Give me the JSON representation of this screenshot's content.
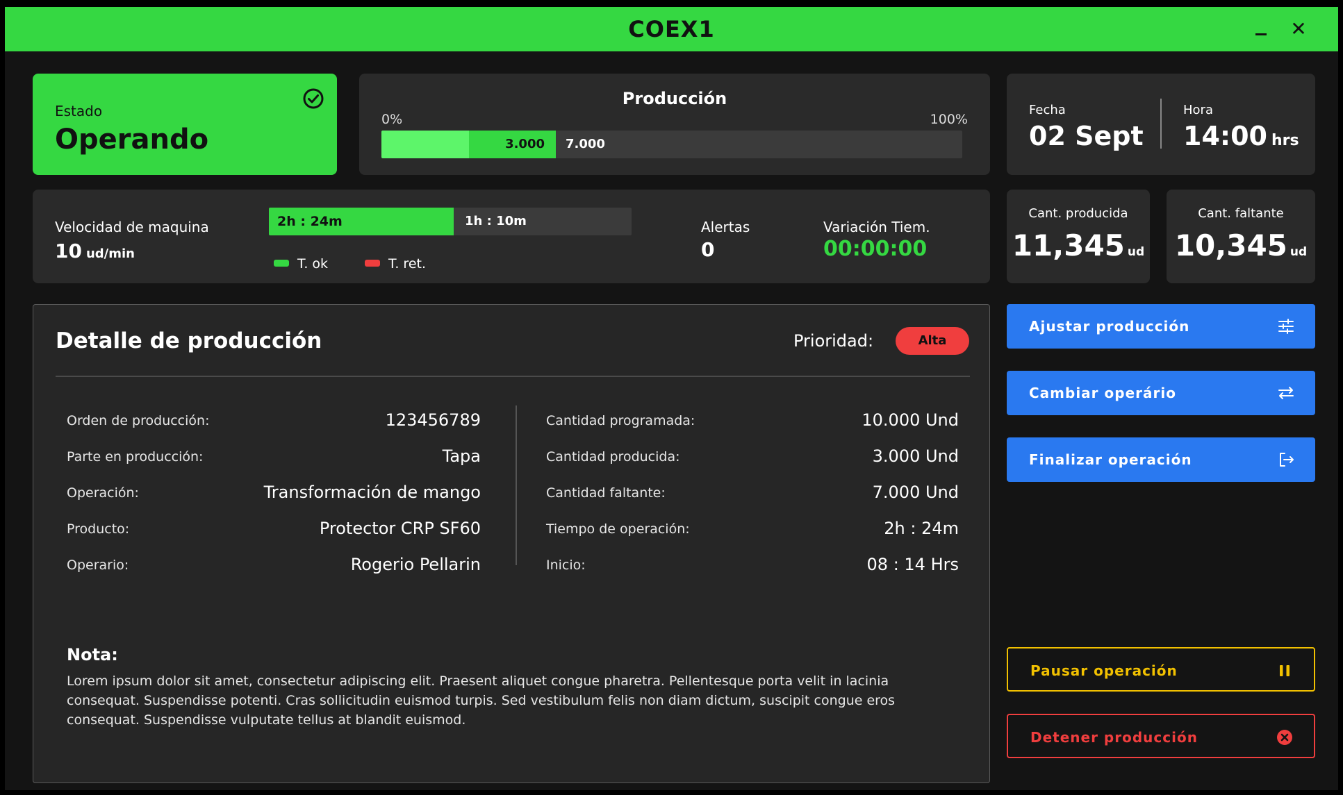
{
  "window": {
    "title": "COEX1",
    "minimize_label": "_",
    "close_label": "✕"
  },
  "estado": {
    "label": "Estado",
    "value": "Operando"
  },
  "produccion": {
    "title": "Producción",
    "min_label": "0%",
    "max_label": "100%",
    "produced_label": "3.000",
    "remaining_label": "7.000",
    "progress_fraction": 0.3
  },
  "fecha": {
    "label": "Fecha",
    "value": "02 Sept"
  },
  "hora": {
    "label": "Hora",
    "value": "14:00",
    "unit": "hrs"
  },
  "velocidad": {
    "label": "Velocidad de maquina",
    "value": "10",
    "unit": "ud/min"
  },
  "tiempos": {
    "ok_value": "2h : 24m",
    "ret_value": "1h : 10m",
    "legend_ok": "T. ok",
    "legend_ret": "T. ret.",
    "ok_color": "#35d842",
    "ret_color": "#f03e3e"
  },
  "alertas": {
    "label": "Alertas",
    "value": "0"
  },
  "variacion": {
    "label": "Variación Tiem.",
    "value": "00:00:00"
  },
  "cant_producida": {
    "label": "Cant. producida",
    "value": "11,345",
    "unit": "ud"
  },
  "cant_faltante": {
    "label": "Cant. faltante",
    "value": "10,345",
    "unit": "ud"
  },
  "detalle": {
    "title": "Detalle de producción",
    "prioridad_label": "Prioridad:",
    "prioridad_value": "Alta",
    "left": [
      {
        "key": "Orden de producción:",
        "value": "123456789"
      },
      {
        "key": "Parte en producción:",
        "value": "Tapa"
      },
      {
        "key": "Operación:",
        "value": "Transformación de mango"
      },
      {
        "key": "Producto:",
        "value": "Protector CRP SF60"
      },
      {
        "key": "Operario:",
        "value": "Rogerio Pellarin"
      }
    ],
    "right": [
      {
        "key": "Cantidad programada:",
        "value": "10.000 Und"
      },
      {
        "key": "Cantidad producida:",
        "value": "3.000 Und"
      },
      {
        "key": "Cantidad faltante:",
        "value": "7.000 Und"
      },
      {
        "key": "Tiempo de operación:",
        "value": "2h : 24m"
      },
      {
        "key": "Inicio:",
        "value": "08 : 14 Hrs"
      }
    ],
    "nota_label": "Nota:",
    "nota_text": "Lorem ipsum dolor sit amet, consectetur adipiscing elit. Praesent aliquet congue pharetra. Pellentesque porta velit in lacinia consequat. Suspendisse potenti. Cras sollicitudin euismod turpis. Sed vestibulum felis non diam dictum, suscipit congue eros consequat. Suspendisse vulputate tellus at blandit euismod."
  },
  "actions": {
    "ajustar": {
      "label": "Ajustar producción",
      "icon": "sliders-icon"
    },
    "cambiar": {
      "label": "Cambiar operário",
      "icon": "swap-arrows-icon"
    },
    "finalizar": {
      "label": "Finalizar operación",
      "icon": "logout-icon"
    },
    "pausar": {
      "label": "Pausar operación",
      "icon": "pause-icon"
    },
    "detener": {
      "label": "Detener producción",
      "icon": "stop-circle-icon"
    }
  },
  "colors": {
    "accent_green": "#35d842",
    "accent_blue": "#2a79f0",
    "warning_yellow": "#f2c100",
    "danger_red": "#f03e3e",
    "background": "#141414",
    "card": "#2a2a2a"
  }
}
